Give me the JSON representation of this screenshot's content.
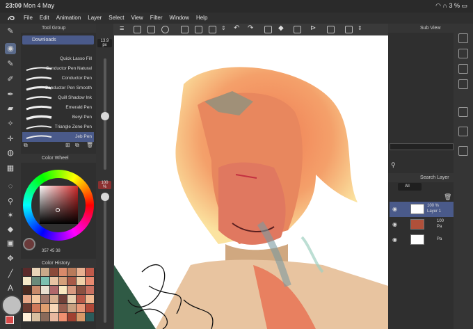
{
  "status": {
    "time": "23:00",
    "date": "Mon 4 May",
    "battery": "3 %"
  },
  "menu": [
    "File",
    "Edit",
    "Animation",
    "Layer",
    "Select",
    "View",
    "Filter",
    "Window",
    "Help"
  ],
  "tool_group": {
    "title": "Tool Group",
    "folder": "Downloads"
  },
  "brushes": [
    "Quick Lasso Fill",
    "Conductor Pen Natural",
    "Conductor Pen",
    "Conductor Pen Smooth",
    "Quill Shadow Ink",
    "Emerald Pen",
    "Beryl Pen",
    "Triangle Zone Pen",
    "Jeb Pen"
  ],
  "color_wheel": {
    "title": "Color Wheel",
    "h": "357",
    "s": "45",
    "v": "38"
  },
  "color_history": {
    "title": "Color History",
    "colors": [
      "#5a2a2a",
      "#e8d4b8",
      "#c9a98a",
      "#8a4a3a",
      "#d88a6a",
      "#b87a5a",
      "#e8b090",
      "#c05a4a",
      "#f4e8c8",
      "#6a8a7a",
      "#7ac0b0",
      "#e8c4a4",
      "#d4a07a",
      "#a85a48",
      "#f0d0a8",
      "#e88a70",
      "#4a2a20",
      "#c88a6a",
      "#e8e0d0",
      "#b0686a",
      "#f8e8c0",
      "#d89a80",
      "#8a5040",
      "#c87060",
      "#e8a888",
      "#f4c8a0",
      "#a0786a",
      "#d8b090",
      "#704038",
      "#e8d0b0",
      "#b85848",
      "#f0b890",
      "#6a3a30",
      "#d07a5a",
      "#e0a070",
      "#f8d8b8",
      "#9a6050",
      "#c8a080",
      "#e89878",
      "#b04838",
      "#fff0d8",
      "#d8c0a0",
      "#8a6a5a",
      "#e8b8a0",
      "#f09070",
      "#a04030",
      "#d89868",
      "#2a5a5a"
    ]
  },
  "brush_size": "13.9",
  "size_unit": "px",
  "opacity": "100",
  "opacity_unit": "%",
  "sub_view": {
    "title": "Sub View"
  },
  "layer_panel": {
    "title": "Search Layer",
    "blend": "All",
    "layers": [
      {
        "name": "Layer 1",
        "opacity": "100 %"
      },
      {
        "name": "Pa",
        "opacity": "100"
      },
      {
        "name": "Pa",
        "opacity": ""
      }
    ]
  }
}
